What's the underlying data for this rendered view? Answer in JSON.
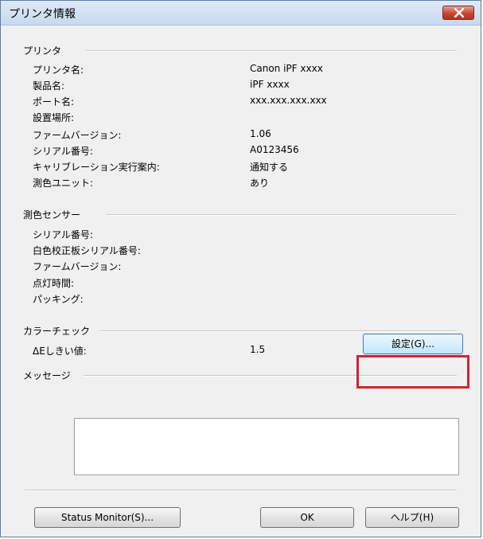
{
  "window": {
    "title": "プリンタ情報"
  },
  "printer_group": {
    "title": "プリンタ",
    "rows": [
      {
        "label": "プリンタ名:",
        "value": "Canon iPF xxxx"
      },
      {
        "label": "製品名:",
        "value": "iPF xxxx"
      },
      {
        "label": "ポート名:",
        "value": "xxx.xxx.xxx.xxx"
      },
      {
        "label": "設置場所:",
        "value": ""
      },
      {
        "label": "ファームバージョン:",
        "value": "1.06"
      },
      {
        "label": "シリアル番号:",
        "value": "A0123456"
      },
      {
        "label": "キャリブレーション実行案内:",
        "value": "通知する"
      },
      {
        "label": "測色ユニット:",
        "value": "あり"
      }
    ]
  },
  "sensor_group": {
    "title": "測色センサー",
    "rows": [
      {
        "label": "シリアル番号:"
      },
      {
        "label": "白色校正板シリアル番号:"
      },
      {
        "label": "ファームバージョン:"
      },
      {
        "label": "点灯時間:"
      },
      {
        "label": "パッキング:"
      }
    ]
  },
  "color_check_group": {
    "title": "カラーチェック",
    "threshold_label": "ΔEしきい値:",
    "threshold_value": "1.5",
    "settings_button": "設定(G)..."
  },
  "message_group": {
    "title": "メッセージ",
    "text": ""
  },
  "buttons": {
    "status_monitor": "Status Monitor(S)...",
    "ok": "OK",
    "help": "ヘルプ(H)"
  },
  "colors": {
    "highlight": "#d0252e",
    "close_button": "#c9452f"
  }
}
